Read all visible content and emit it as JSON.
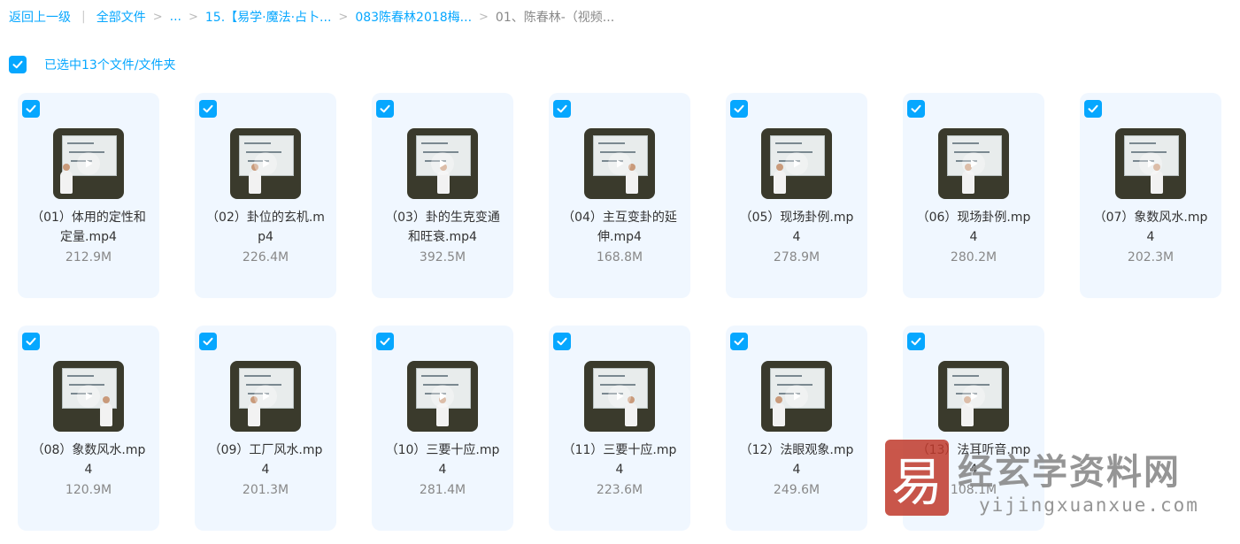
{
  "breadcrumb": {
    "back": "返回上一级",
    "all_files": "全部文件",
    "ellipsis": "...",
    "level1": "15.【易学·魔法·占卜...",
    "level2": "083陈春林2018梅...",
    "current": "01、陈春林-（视频..."
  },
  "selection": {
    "text": "已选中13个文件/文件夹"
  },
  "files": [
    {
      "name": "（01）体用的定性和定量.mp4",
      "size": "212.9M"
    },
    {
      "name": "（02）卦位的玄机.mp4",
      "size": "226.4M"
    },
    {
      "name": "（03）卦的生克变通和旺衰.mp4",
      "size": "392.5M"
    },
    {
      "name": "（04）主互变卦的延伸.mp4",
      "size": "168.8M"
    },
    {
      "name": "（05）现场卦例.mp4",
      "size": "278.9M"
    },
    {
      "name": "（06）现场卦例.mp4",
      "size": "280.2M"
    },
    {
      "name": "（07）象数风水.mp4",
      "size": "202.3M"
    },
    {
      "name": "（08）象数风水.mp4",
      "size": "120.9M"
    },
    {
      "name": "（09）工厂风水.mp4",
      "size": "201.3M"
    },
    {
      "name": "（10）三要十应.mp4",
      "size": "281.4M"
    },
    {
      "name": "（11）三要十应.mp4",
      "size": "223.6M"
    },
    {
      "name": "（12）法眼观象.mp4",
      "size": "249.6M"
    },
    {
      "name": "（13）法耳听音.mp4",
      "size": "108.1M"
    }
  ],
  "watermark": {
    "logo_char": "易",
    "title": "经玄学资料网",
    "url": "yijingxuanxue.com"
  },
  "colors": {
    "accent": "#06a7ff",
    "card_bg": "#f0f7ff",
    "thumb_bg": "#3a3a2c"
  }
}
